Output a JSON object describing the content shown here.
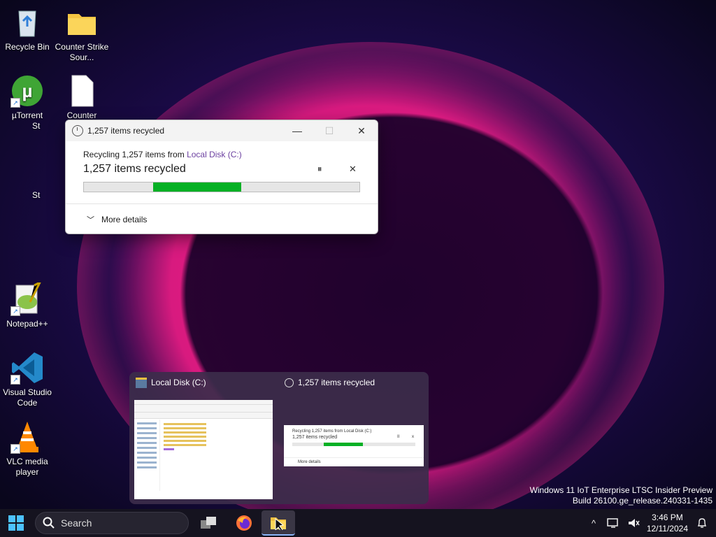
{
  "desktop": {
    "icons": [
      {
        "label": "Recycle Bin",
        "icon": "recycle-bin-icon"
      },
      {
        "label": "Counter Strike Sour...",
        "icon": "folder-icon"
      },
      {
        "label": "µTorrent",
        "icon": "utorrent-icon"
      },
      {
        "label": "Counter",
        "label2": "St",
        "icon": "file-icon"
      },
      {
        "label": "St",
        "icon": "file-icon"
      },
      {
        "label": "Notepad++",
        "icon": "notepadpp-icon"
      },
      {
        "label": "Visual Studio Code",
        "icon": "vscode-icon"
      },
      {
        "label": "VLC media player",
        "icon": "vlc-icon"
      }
    ]
  },
  "dialog": {
    "title": "1,257 items recycled",
    "recycling_prefix": "Recycling 1,257 items from",
    "source": "Local Disk (C:)",
    "status": "1,257 items recycled",
    "pause": "⏸",
    "cancel": "✕",
    "more_details": "More details",
    "progress_start_fraction": 0.25,
    "progress_end_fraction": 0.57
  },
  "thumbnails": {
    "explorer_title": "Local Disk (C:)",
    "dialog_title": "1,257 items recycled",
    "mini_line1": "Recycling 1,257 items from Local Disk (C:)",
    "mini_line2": "1,257 items recycled",
    "mini_more": "More details",
    "mini_pause": "II",
    "mini_close": "x"
  },
  "watermark": {
    "line1": "Windows 11 IoT Enterprise LTSC Insider Preview",
    "line2": "Build 26100.ge_release.240331-1435"
  },
  "taskbar": {
    "search_placeholder": "Search",
    "time": "3:46 PM",
    "date": "12/11/2024",
    "tray_chevron": "^"
  },
  "colors": {
    "accent_progress": "#06b025",
    "link": "#6b3fa0"
  }
}
